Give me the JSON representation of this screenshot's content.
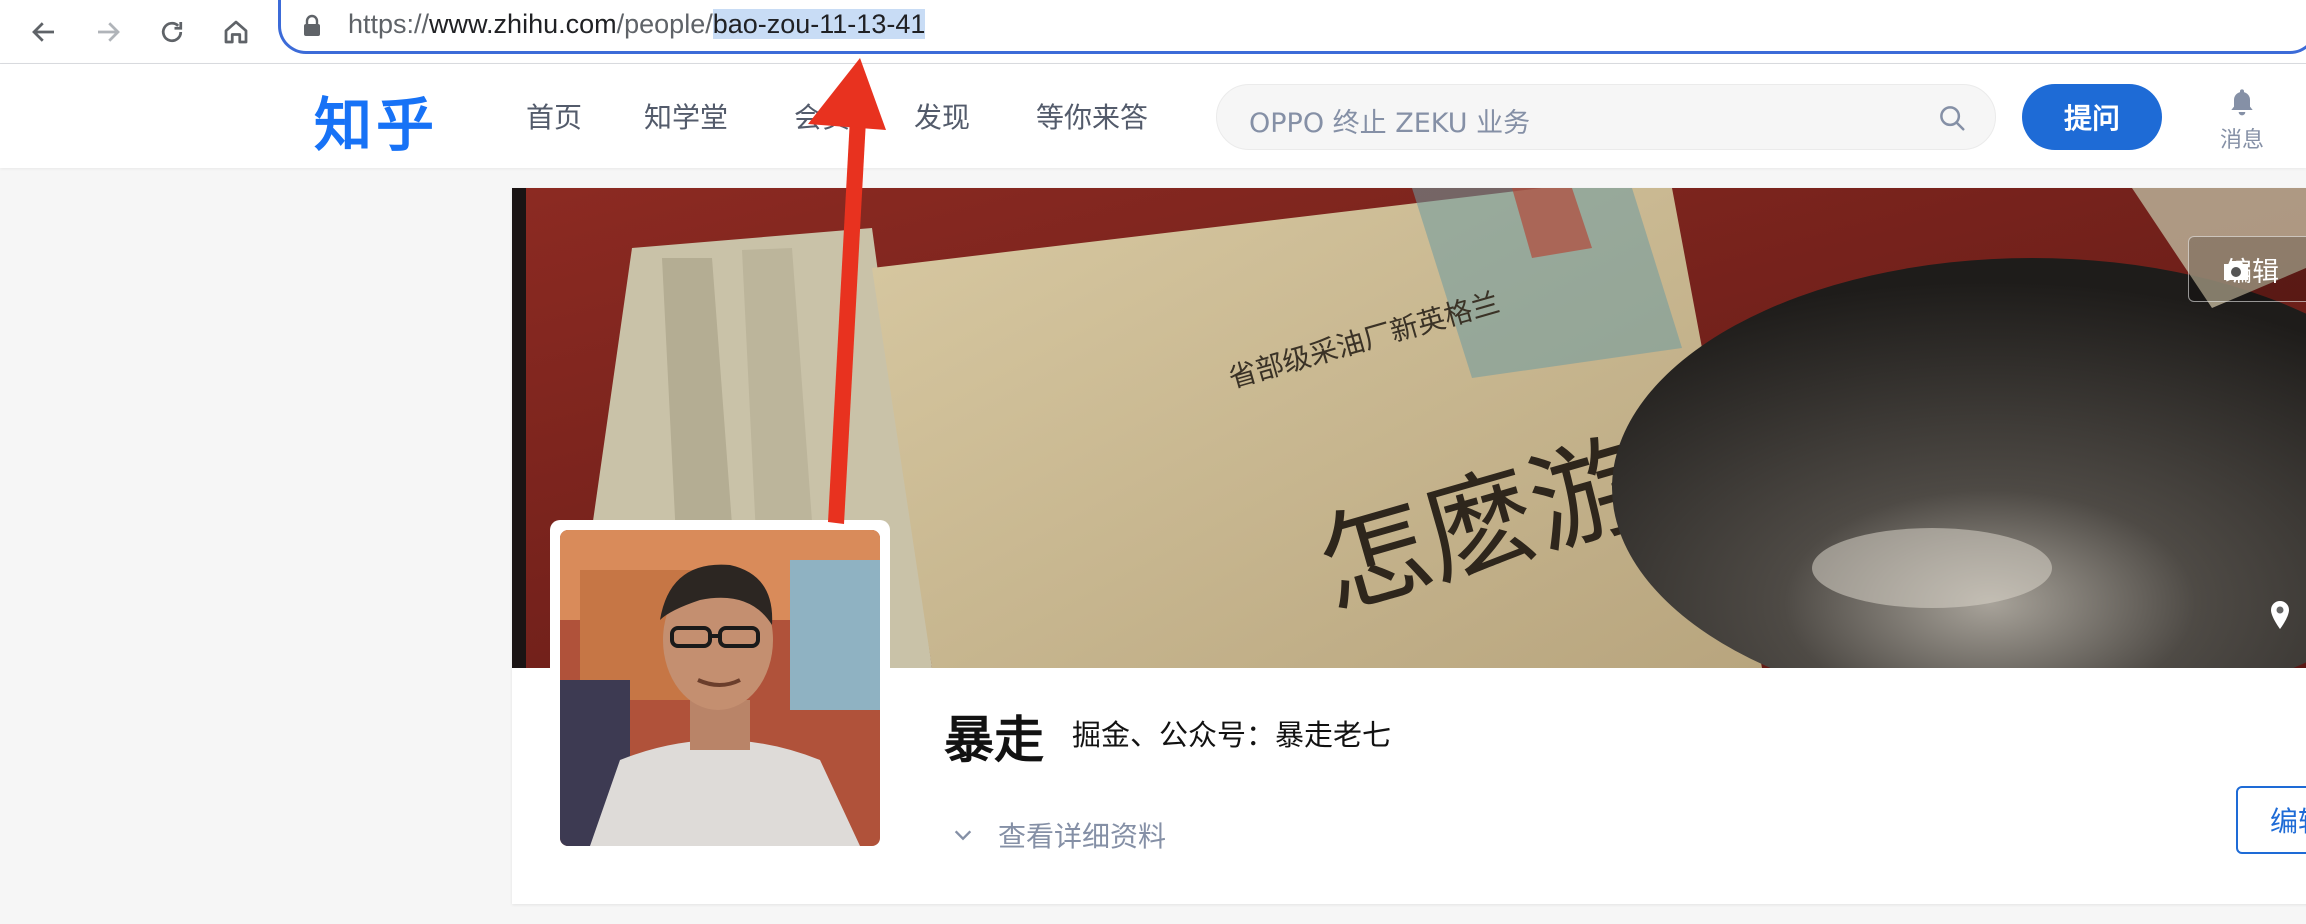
{
  "browser": {
    "url_prefix": "https://",
    "url_host": "www.zhihu.com",
    "url_path": "/people/",
    "url_selected": "bao-zou-11-13-41",
    "icons": [
      "back-icon",
      "forward-icon",
      "reload-icon",
      "home-icon",
      "lock-icon"
    ]
  },
  "header": {
    "logo": "知乎",
    "nav": [
      "首页",
      "知学堂",
      "会员",
      "发现",
      "等你来答"
    ],
    "search_placeholder": "OPPO 终止 ZEKU 业务",
    "ask_label": "提问",
    "messages_label": "消息"
  },
  "profile": {
    "name": "暴走",
    "headline": "掘金、公众号：暴走老七",
    "details_label": "查看详细资料",
    "edit_cover_label": "编辑",
    "edit_profile_label": "编辑"
  },
  "colors": {
    "brand": "#1772f6",
    "ask_button": "#1e6bd6",
    "annotation_arrow": "#e8321f",
    "url_selection": "#c8dcf5"
  }
}
